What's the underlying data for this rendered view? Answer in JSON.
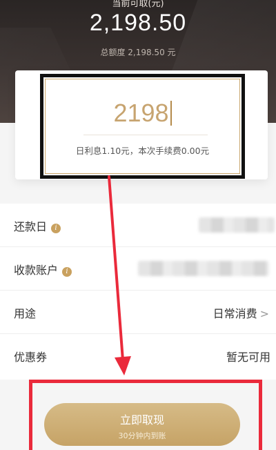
{
  "header": {
    "available_label": "当前可取(元)",
    "available_amount": "2,198.50",
    "total_limit": "总额度 2,198.50 元"
  },
  "withdraw": {
    "amount_value": "2198",
    "fee_text": "日利息1.10元，本次手续费0.00元"
  },
  "rows": {
    "repay_date": {
      "label": "还款日"
    },
    "receive_account": {
      "label": "收款账户"
    },
    "purpose": {
      "label": "用途",
      "value": "日常消费",
      "chevron": ">"
    },
    "coupon": {
      "label": "优惠券",
      "value": "暂无可用"
    }
  },
  "action": {
    "button_label": "立即取现",
    "button_sub": "30分钟内到账"
  },
  "icons": {
    "info": "info-icon",
    "chevron": "chevron-right-icon"
  },
  "colors": {
    "accent_gold": "#c7a470",
    "annotation_red": "#ea2a3b",
    "annotation_black": "#111111"
  }
}
